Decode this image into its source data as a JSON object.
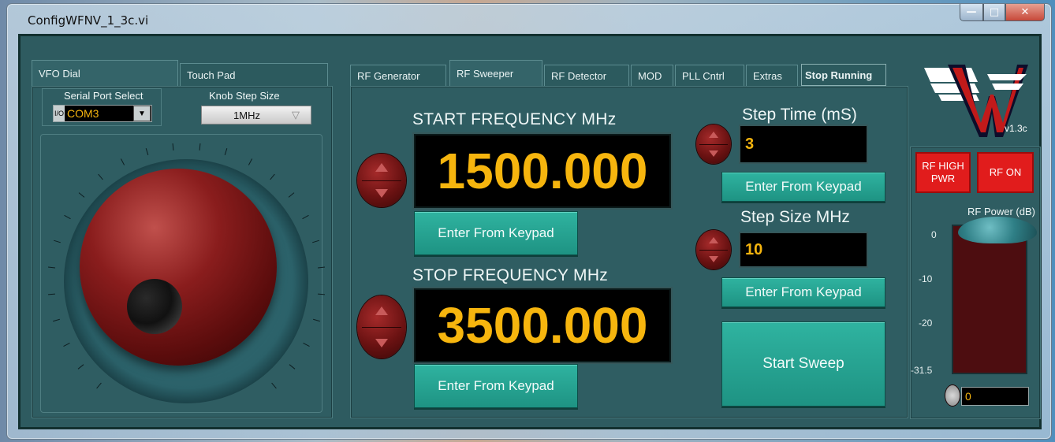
{
  "window": {
    "title": "ConfigWFNV_1_3c.vi"
  },
  "left_tabs": [
    {
      "label": "VFO Dial"
    },
    {
      "label": "Touch Pad"
    }
  ],
  "serial": {
    "label": "Serial Port Select",
    "io_glyph": "I/O",
    "value": "COM3"
  },
  "knob_step": {
    "label": "Knob Step Size",
    "value": "1MHz"
  },
  "main_tabs": [
    {
      "label": "RF Generator"
    },
    {
      "label": "RF Sweeper"
    },
    {
      "label": "RF Detector"
    },
    {
      "label": "MOD"
    },
    {
      "label": "PLL Cntrl"
    },
    {
      "label": "Extras"
    },
    {
      "label": "Stop Running"
    }
  ],
  "start_freq": {
    "label": "START FREQUENCY MHz",
    "value": "1500.000",
    "keypad_label": "Enter From Keypad"
  },
  "stop_freq": {
    "label": "STOP FREQUENCY MHz",
    "value": "3500.000",
    "keypad_label": "Enter From Keypad"
  },
  "step_time": {
    "label": "Step Time (mS)",
    "value": "3",
    "keypad_label": "Enter From Keypad"
  },
  "step_size": {
    "label": "Step Size MHz",
    "value": "10",
    "keypad_label": "Enter From Keypad"
  },
  "start_sweep_label": "Start Sweep",
  "version": "v1.3c",
  "rf_high_pwr_label": "RF HIGH PWR",
  "rf_on_label": "RF ON",
  "rf_power": {
    "label": "RF Power (dB)",
    "scale": [
      "0",
      "-10",
      "-20",
      "-31.5"
    ],
    "value": "0",
    "level_db": 0
  },
  "colors": {
    "accent": "#f6b50e",
    "panel": "#2e5b60",
    "button": "#22a08f",
    "alarm": "#e11c1c"
  }
}
